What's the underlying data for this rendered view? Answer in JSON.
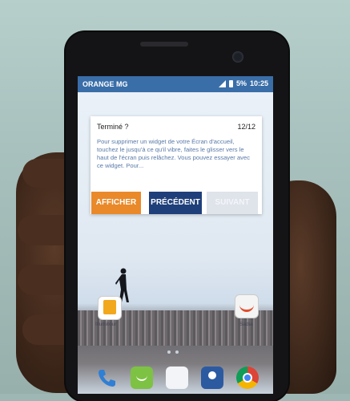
{
  "status_bar": {
    "carrier": "ORANGE MG",
    "battery": "5%",
    "time": "10:25"
  },
  "dialog": {
    "title": "Terminé ?",
    "step": "12/12",
    "body": "Pour supprimer un widget de votre Écran d'accueil, touchez le jusqu'à ce qu'il vibre, faites le glisser vers le haut de l'écran puis relâchez. Vous pouvez essayer avec ce widget. Pour..."
  },
  "buttons": {
    "show": "AFFICHER",
    "previous": "PRÉCÉDENT",
    "next": "SUIVANT"
  },
  "home": {
    "left_app_label": "Illumitour",
    "right_app_label": "Sadia"
  },
  "colors": {
    "status_bar": "#3a6ea8",
    "afficher": "#e9892a",
    "precedent": "#1f3f7a",
    "body_text": "#5a7aa8"
  },
  "icons": [
    "phone-icon",
    "messaging-icon",
    "apps-icon",
    "contacts-icon",
    "chrome-icon"
  ]
}
